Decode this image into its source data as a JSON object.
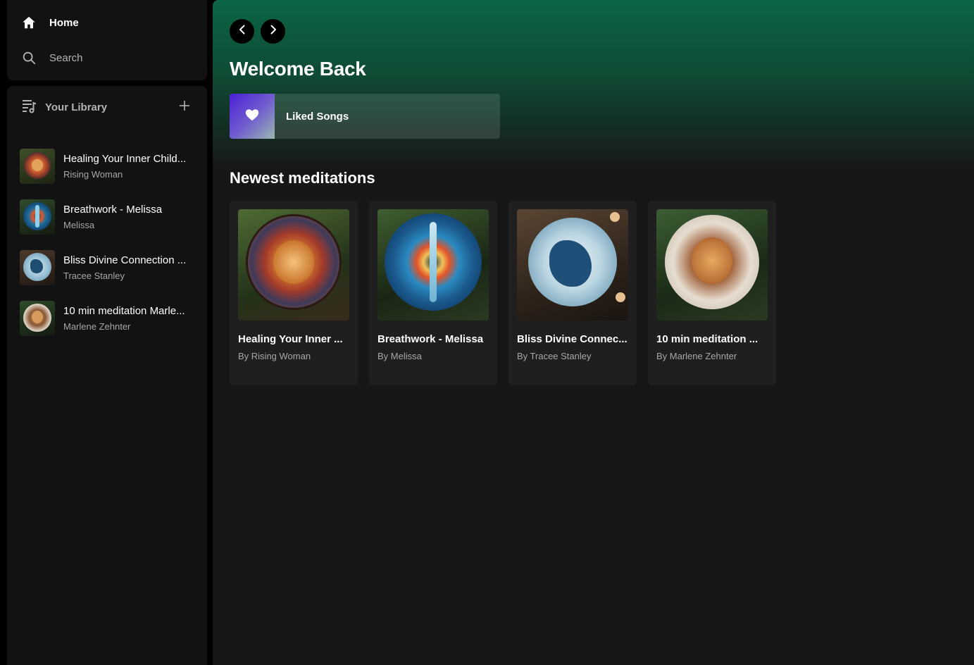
{
  "sidebar": {
    "nav": {
      "home_label": "Home",
      "search_label": "Search"
    },
    "library": {
      "title": "Your Library",
      "items": [
        {
          "name": "Healing Your Inner Child...",
          "sub": "Rising Woman",
          "art": "lion-red"
        },
        {
          "name": "Breathwork - Melissa",
          "sub": "Melissa",
          "art": "mandala-blue"
        },
        {
          "name": "Bliss Divine Connection ...",
          "sub": "Tracee Stanley",
          "art": "wolf-white"
        },
        {
          "name": "10 min meditation Marle...",
          "sub": "Marlene Zehnter",
          "art": "lion-gold"
        }
      ]
    }
  },
  "main": {
    "welcome": "Welcome Back",
    "liked": {
      "label": "Liked Songs",
      "icon": "heart-icon"
    },
    "section_title": "Newest meditations",
    "cards": [
      {
        "title": "Healing Your Inner ...",
        "sub": "By Rising Woman",
        "art": "lion-red"
      },
      {
        "title": "Breathwork - Melissa",
        "sub": "By Melissa",
        "art": "mandala-blue"
      },
      {
        "title": "Bliss Divine Connec...",
        "sub": "By Tracee Stanley",
        "art": "wolf-white"
      },
      {
        "title": "10 min meditation ...",
        "sub": "By Marlene Zehnter",
        "art": "lion-gold"
      }
    ]
  },
  "colors": {
    "accent_green": "#0b6646",
    "surface": "#121212",
    "main_bg": "#171717",
    "card_bg": "#1f1f1f",
    "muted_text": "#a7a7a7"
  }
}
